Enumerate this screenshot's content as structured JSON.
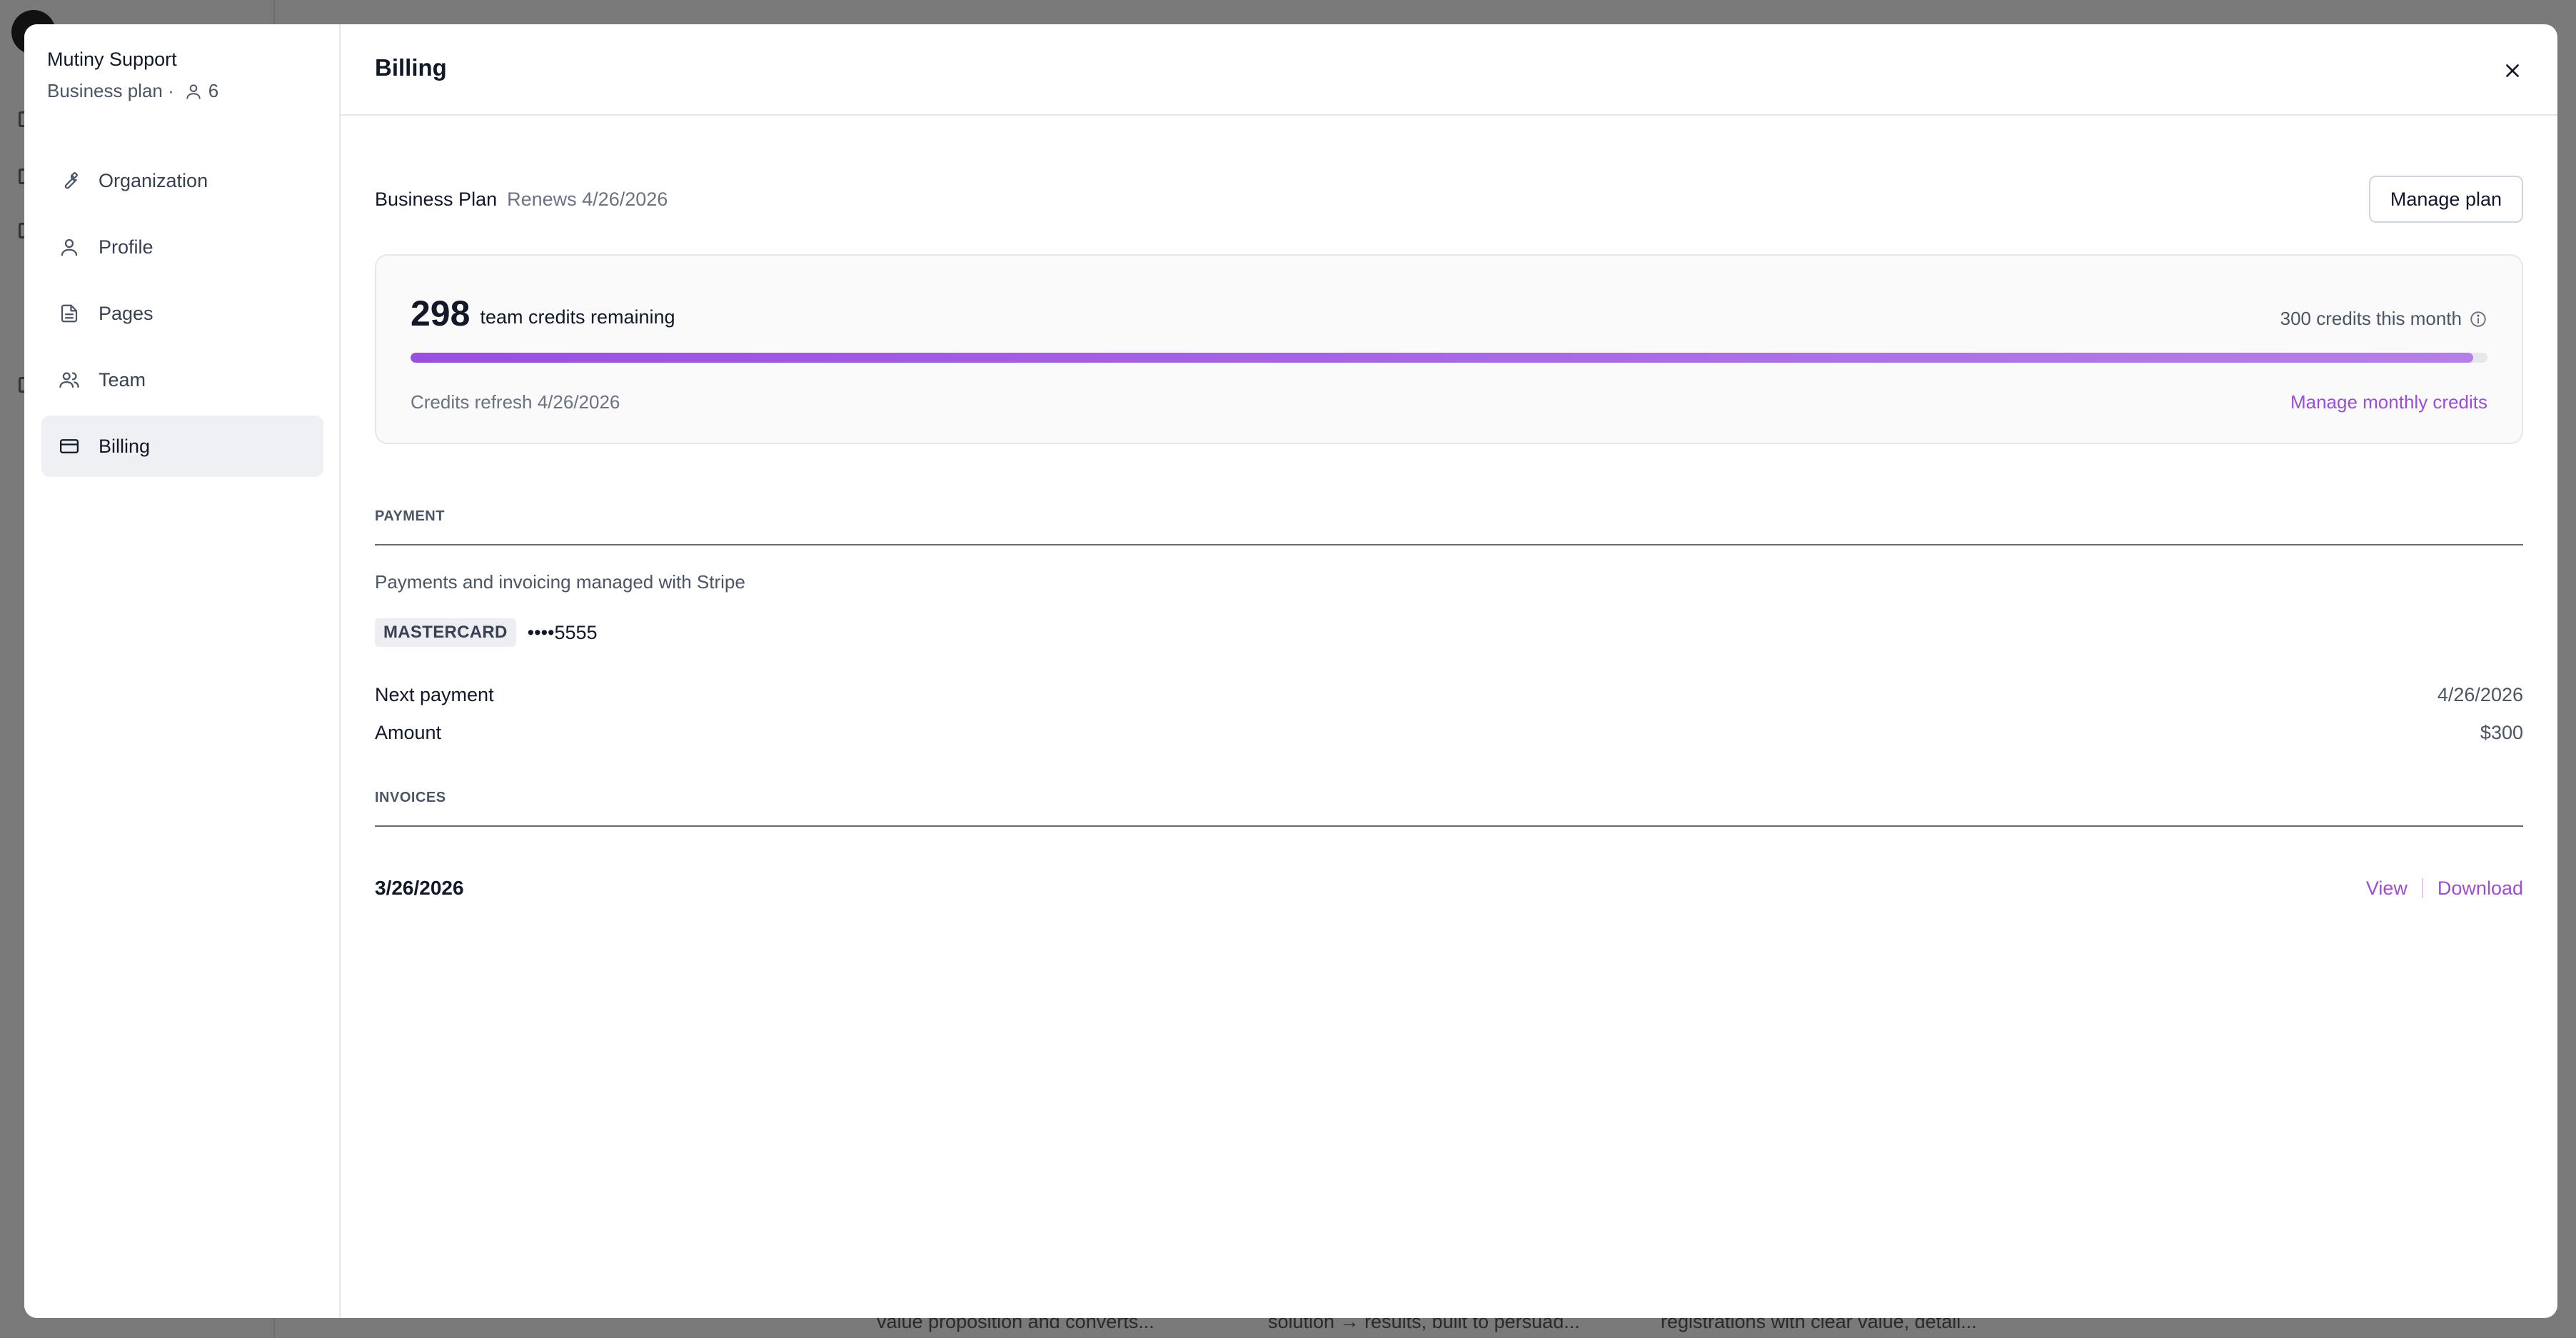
{
  "background": {
    "card_snippets": [
      "value proposition and converts...",
      "solution → results, built to persuad...",
      "registrations with clear value, detail..."
    ]
  },
  "sidebar": {
    "org_name": "Mutiny Support",
    "plan_label": "Business plan ·",
    "member_count": "6",
    "items": [
      {
        "label": "Organization",
        "icon": "wrench-icon"
      },
      {
        "label": "Profile",
        "icon": "user-icon"
      },
      {
        "label": "Pages",
        "icon": "document-icon"
      },
      {
        "label": "Team",
        "icon": "team-icon"
      },
      {
        "label": "Billing",
        "icon": "credit-card-icon",
        "active": true
      }
    ]
  },
  "header": {
    "title": "Billing",
    "close_icon": "close-icon"
  },
  "plan": {
    "name": "Business Plan",
    "renews": "Renews 4/26/2026",
    "manage_label": "Manage plan"
  },
  "credits": {
    "remaining": "298",
    "remaining_label": "team credits remaining",
    "monthly": "300 credits this month",
    "progress_fraction": 0.993,
    "refresh": "Credits refresh 4/26/2026",
    "manage_label": "Manage monthly credits"
  },
  "payment": {
    "section_label": "PAYMENT",
    "description": "Payments and invoicing managed with Stripe",
    "card_brand": "MASTERCARD",
    "card_last4": "••••5555",
    "next_payment_label": "Next payment",
    "next_payment_value": "4/26/2026",
    "amount_label": "Amount",
    "amount_value": "$300"
  },
  "invoices": {
    "section_label": "INVOICES",
    "rows": [
      {
        "date": "3/26/2026",
        "view_label": "View",
        "download_label": "Download"
      }
    ]
  },
  "colors": {
    "accent": "#9b4ed6",
    "progress_start": "#9a4fe0",
    "progress_end": "#b67ee8",
    "overlay": "#7a7a7a"
  }
}
